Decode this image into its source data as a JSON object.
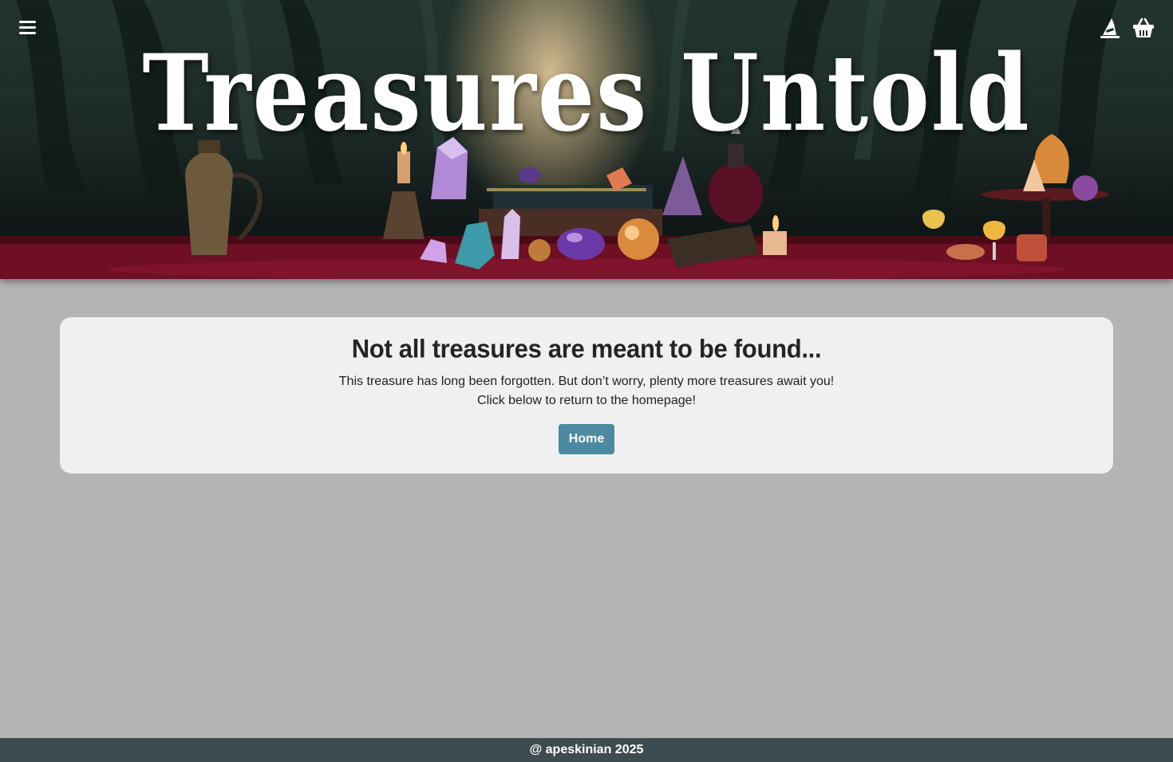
{
  "header": {
    "title": "Treasures Untold",
    "icons": {
      "menu": "menu-icon",
      "account": "witch-hat-icon",
      "cart": "shopping-basket-icon"
    }
  },
  "error_card": {
    "heading": "Not all treasures are meant to be found...",
    "line1": "This treasure has long been forgotten. But don’t worry, plenty more treasures await you!",
    "line2": "Click below to return to the homepage!",
    "home_button": "Home"
  },
  "footer": {
    "text": "@ apeskinian 2025"
  },
  "colors": {
    "page_background": "#b4b4b4",
    "card_background": "#f0f0f0",
    "button": "#4b8aa0",
    "footer": "#3d4c51",
    "table_cloth": "#6e0f24"
  }
}
